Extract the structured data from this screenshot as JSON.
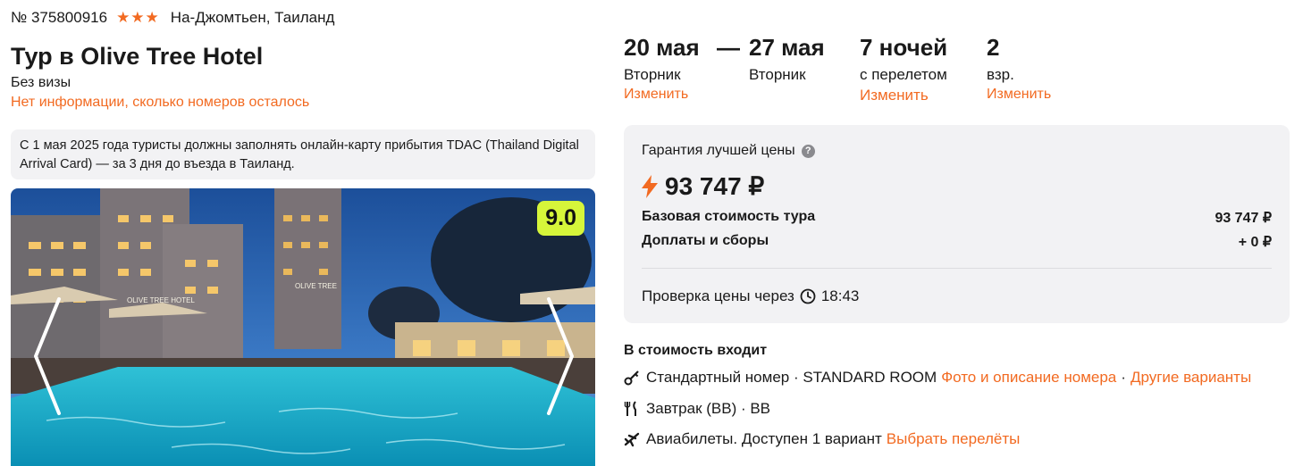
{
  "header": {
    "tour_number": "№ 375800916",
    "stars": "★★★",
    "location": "На-Джомтьен, Таиланд",
    "title": "Тур в Olive Tree Hotel",
    "visa": "Без визы",
    "rooms_info": "Нет информации, сколько номеров осталось"
  },
  "notice": {
    "text": "С 1 мая 2025 года туристы должны заполнять онлайн-карту прибытия TDAC (Thailand Digital Arrival Card) — за 3 дня до въезда в Таиланд."
  },
  "photo": {
    "rating": "9.0",
    "sign_left": "OLIVE TREE HOTEL",
    "sign_right": "OLIVE TREE"
  },
  "dates": {
    "from_date": "20 мая",
    "from_day": "Вторник",
    "dash": "—",
    "to_date": "27 мая",
    "to_day": "Вторник",
    "change_label": "Изменить",
    "nights": "7 ночей",
    "nights_sub": "с перелетом",
    "nights_change": "Изменить",
    "adults": "2",
    "adults_sub": "взр.",
    "adults_change": "Изменить"
  },
  "price": {
    "guarantee": "Гарантия лучшей цены",
    "info_icon": "?",
    "total": "93 747 ₽",
    "base_label": "Базовая стоимость тура",
    "base_value": "93 747 ₽",
    "fees_label": "Доплаты и сборы",
    "fees_value": "+ 0 ₽",
    "check_label": "Проверка цены через",
    "check_time": "18:43"
  },
  "included": {
    "title": "В стоимость входит",
    "room": "Стандартный номер · STANDARD ROOM",
    "room_link": "Фото и описание номера",
    "dot": "·",
    "other_link": "Другие варианты",
    "meal": "Завтрак (BB) · BB",
    "flights": "Авиабилеты. Доступен 1 вариант",
    "flights_link": "Выбрать перелёты"
  },
  "colors": {
    "accent": "#f26a21",
    "rating_bg": "#d6f53a",
    "panel_bg": "#f2f2f4"
  },
  "icons": [
    "star-icon",
    "info-icon",
    "lightning-icon",
    "clock-icon",
    "key-icon",
    "fork-knife-icon",
    "airplane-icon",
    "chevron-left-icon",
    "chevron-right-icon"
  ]
}
